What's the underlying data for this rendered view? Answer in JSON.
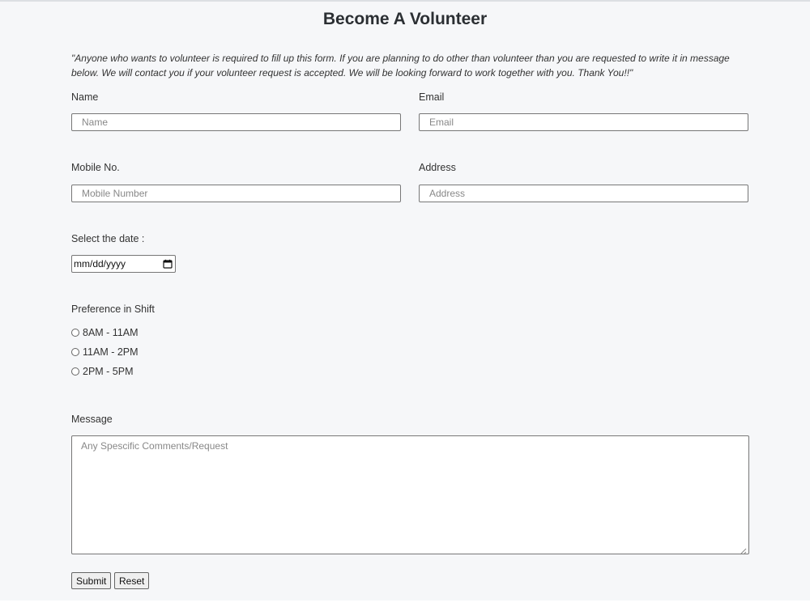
{
  "form": {
    "title": "Become A Volunteer",
    "intro": "\"Anyone who wants to volunteer is required to fill up this form. If you are planning to do other than volunteer than you are requested to write it in message below. We will contact you if your volunteer request is accepted. We will be looking forward to work together with you. Thank You!!\"",
    "name": {
      "label": "Name",
      "placeholder": "Name",
      "value": ""
    },
    "email": {
      "label": "Email",
      "placeholder": "Email",
      "value": ""
    },
    "mobile": {
      "label": "Mobile No.",
      "placeholder": "Mobile Number",
      "value": ""
    },
    "address": {
      "label": "Address",
      "placeholder": "Address",
      "value": ""
    },
    "date": {
      "label": "Select the date :",
      "value": "mm/dd/yyyy"
    },
    "shift": {
      "label": "Preference in Shift",
      "options": [
        "8AM - 11AM",
        "11AM - 2PM",
        "2PM - 5PM"
      ]
    },
    "message": {
      "label": "Message",
      "placeholder": "Any Spescific Comments/Request",
      "value": ""
    },
    "buttons": {
      "submit": "Submit",
      "reset": "Reset"
    }
  },
  "icons": {
    "date_picker": "calendar-icon",
    "radio": "radio-unchecked-icon",
    "textarea_resize": "resize-grip-icon"
  },
  "colors": {
    "page_background": "#f6f7f9",
    "input_border": "#777777",
    "button_background": "#efefef"
  }
}
